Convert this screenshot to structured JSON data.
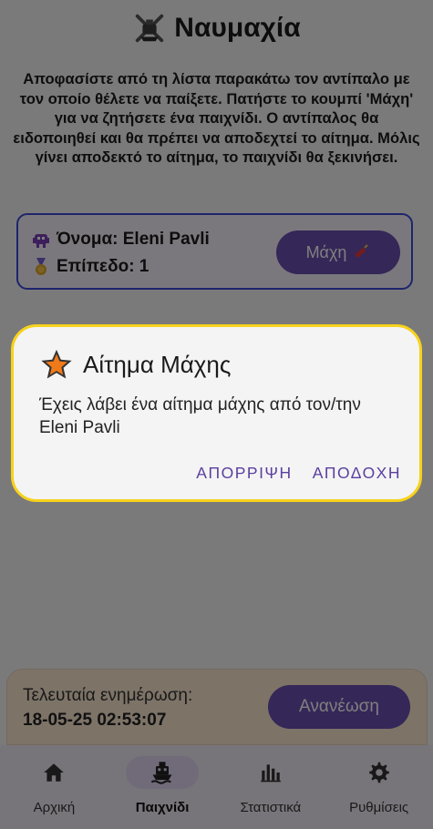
{
  "header": {
    "title": "Ναυμαχία",
    "logo_icon": "crossed-swords-ship-icon"
  },
  "intro_text": "Αποφασίστε από τη λίστα παρακάτω τον αντίπαλο με τον οποίο θέλετε να παίξετε. Πατήστε το κουμπί 'Μάχη' για να ζητήσετε ένα παιχνίδι. Ο αντίπαλος θα ειδοποιηθεί και θα πρέπει να αποδεχτεί το αίτημα. Μόλις γίνει αποδεκτό το αίτημα, το παιχνίδι θα ξεκινήσει.",
  "opponent": {
    "name_line": "Όνομα: Eleni Pavli",
    "level_line": "Επίπεδο: 1",
    "battle_label": "Μάχη",
    "name_icon": "alien-icon",
    "level_icon": "medal-icon",
    "battle_icon": "dynamite-icon"
  },
  "update": {
    "label": "Τελευταία ενημέρωση:",
    "timestamp": "18-05-25 02:53:07",
    "refresh_label": "Ανανέωση"
  },
  "nav": {
    "items": [
      {
        "label": "Αρχική",
        "icon": "home-icon"
      },
      {
        "label": "Παιχνίδι",
        "icon": "ship-icon"
      },
      {
        "label": "Στατιστικά",
        "icon": "stats-icon"
      },
      {
        "label": "Ρυθμίσεις",
        "icon": "gear-icon"
      }
    ],
    "active_index": 1
  },
  "dialog": {
    "title": "Αίτημα Μάχης",
    "message": "Έχεις λάβει ένα αίτημα μάχης από τον/την Eleni Pavli",
    "reject_label": "ΑΠΟΡΡΙΨΗ",
    "accept_label": "ΑΠΟΔΟΧΗ",
    "icon": "star-icon"
  },
  "colors": {
    "accent": "#6a4fb0",
    "dialog_border": "#f7d21b",
    "card_border": "#3b4bd6",
    "update_card_bg": "#fbe6cf"
  }
}
